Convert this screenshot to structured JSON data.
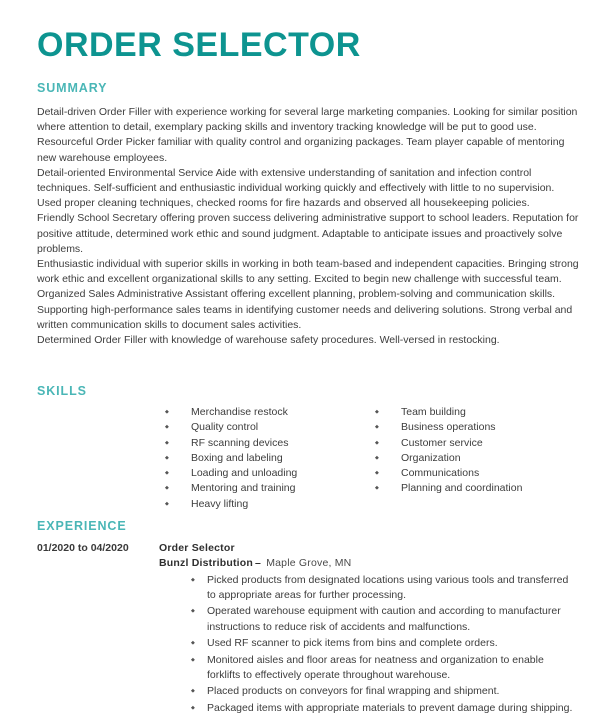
{
  "document": {
    "title": "ORDER SELECTOR",
    "accent_title_color": "#0d9490",
    "accent_heading_color": "#4ab6b6",
    "body_text_color": "#3d3d3d",
    "background_color": "#ffffff"
  },
  "summary": {
    "heading": "SUMMARY",
    "paragraphs": [
      "Detail-driven Order Filler with experience working for several large marketing companies. Looking for similar position where attention to detail, exemplary packing skills and inventory tracking knowledge will be put to good use.",
      "Resourceful Order Picker familiar with quality control and organizing packages. Team player capable of mentoring new warehouse employees.",
      "Detail-oriented Environmental Service Aide with extensive understanding of sanitation and infection control techniques. Self-sufficient and enthusiastic individual working quickly and effectively with little to no supervision. Used proper cleaning techniques, checked rooms for fire hazards and observed all housekeeping policies.",
      "Friendly School Secretary offering proven success delivering administrative support to school leaders. Reputation for positive attitude, determined work ethic and sound judgment. Adaptable to anticipate issues and proactively solve problems.",
      "Enthusiastic individual with superior skills in working in both team-based and independent capacities. Bringing strong work ethic and excellent organizational skills to any setting. Excited to begin new challenge with successful team.",
      "Organized Sales Administrative Assistant offering excellent planning, problem-solving and communication skills. Supporting high-performance sales teams in identifying customer needs and delivering solutions. Strong verbal and written communication skills to document sales activities.",
      "Determined Order Filler with knowledge of warehouse safety procedures. Well-versed in restocking."
    ]
  },
  "skills": {
    "heading": "SKILLS",
    "column_left": [
      "Merchandise restock",
      "Quality control",
      "RF scanning devices",
      "Boxing and labeling",
      "Loading and unloading",
      "Mentoring and training",
      "Heavy lifting"
    ],
    "column_right": [
      "Team building",
      "Business operations",
      "Customer service",
      "Organization",
      "Communications",
      "Planning and coordination"
    ]
  },
  "experience": {
    "heading": "EXPERIENCE",
    "entries": [
      {
        "dates": "01/2020 to 04/2020",
        "job_title": "Order Selector",
        "employer": "Bunzl Distribution",
        "separator": "–",
        "location": "Maple Grove, MN",
        "bullets": [
          "Picked products from designated locations using various tools and transferred to appropriate areas for further processing.",
          "Operated warehouse equipment with caution and according to manufacturer instructions to reduce risk of accidents and malfunctions.",
          "Used RF scanner to pick items from bins and complete orders.",
          "Monitored aisles and floor areas for neatness and organization to enable forklifts to effectively operate throughout warehouse.",
          "Placed products on conveyors for final wrapping and shipment.",
          "Packaged items with appropriate materials to prevent damage during shipping."
        ]
      }
    ]
  }
}
